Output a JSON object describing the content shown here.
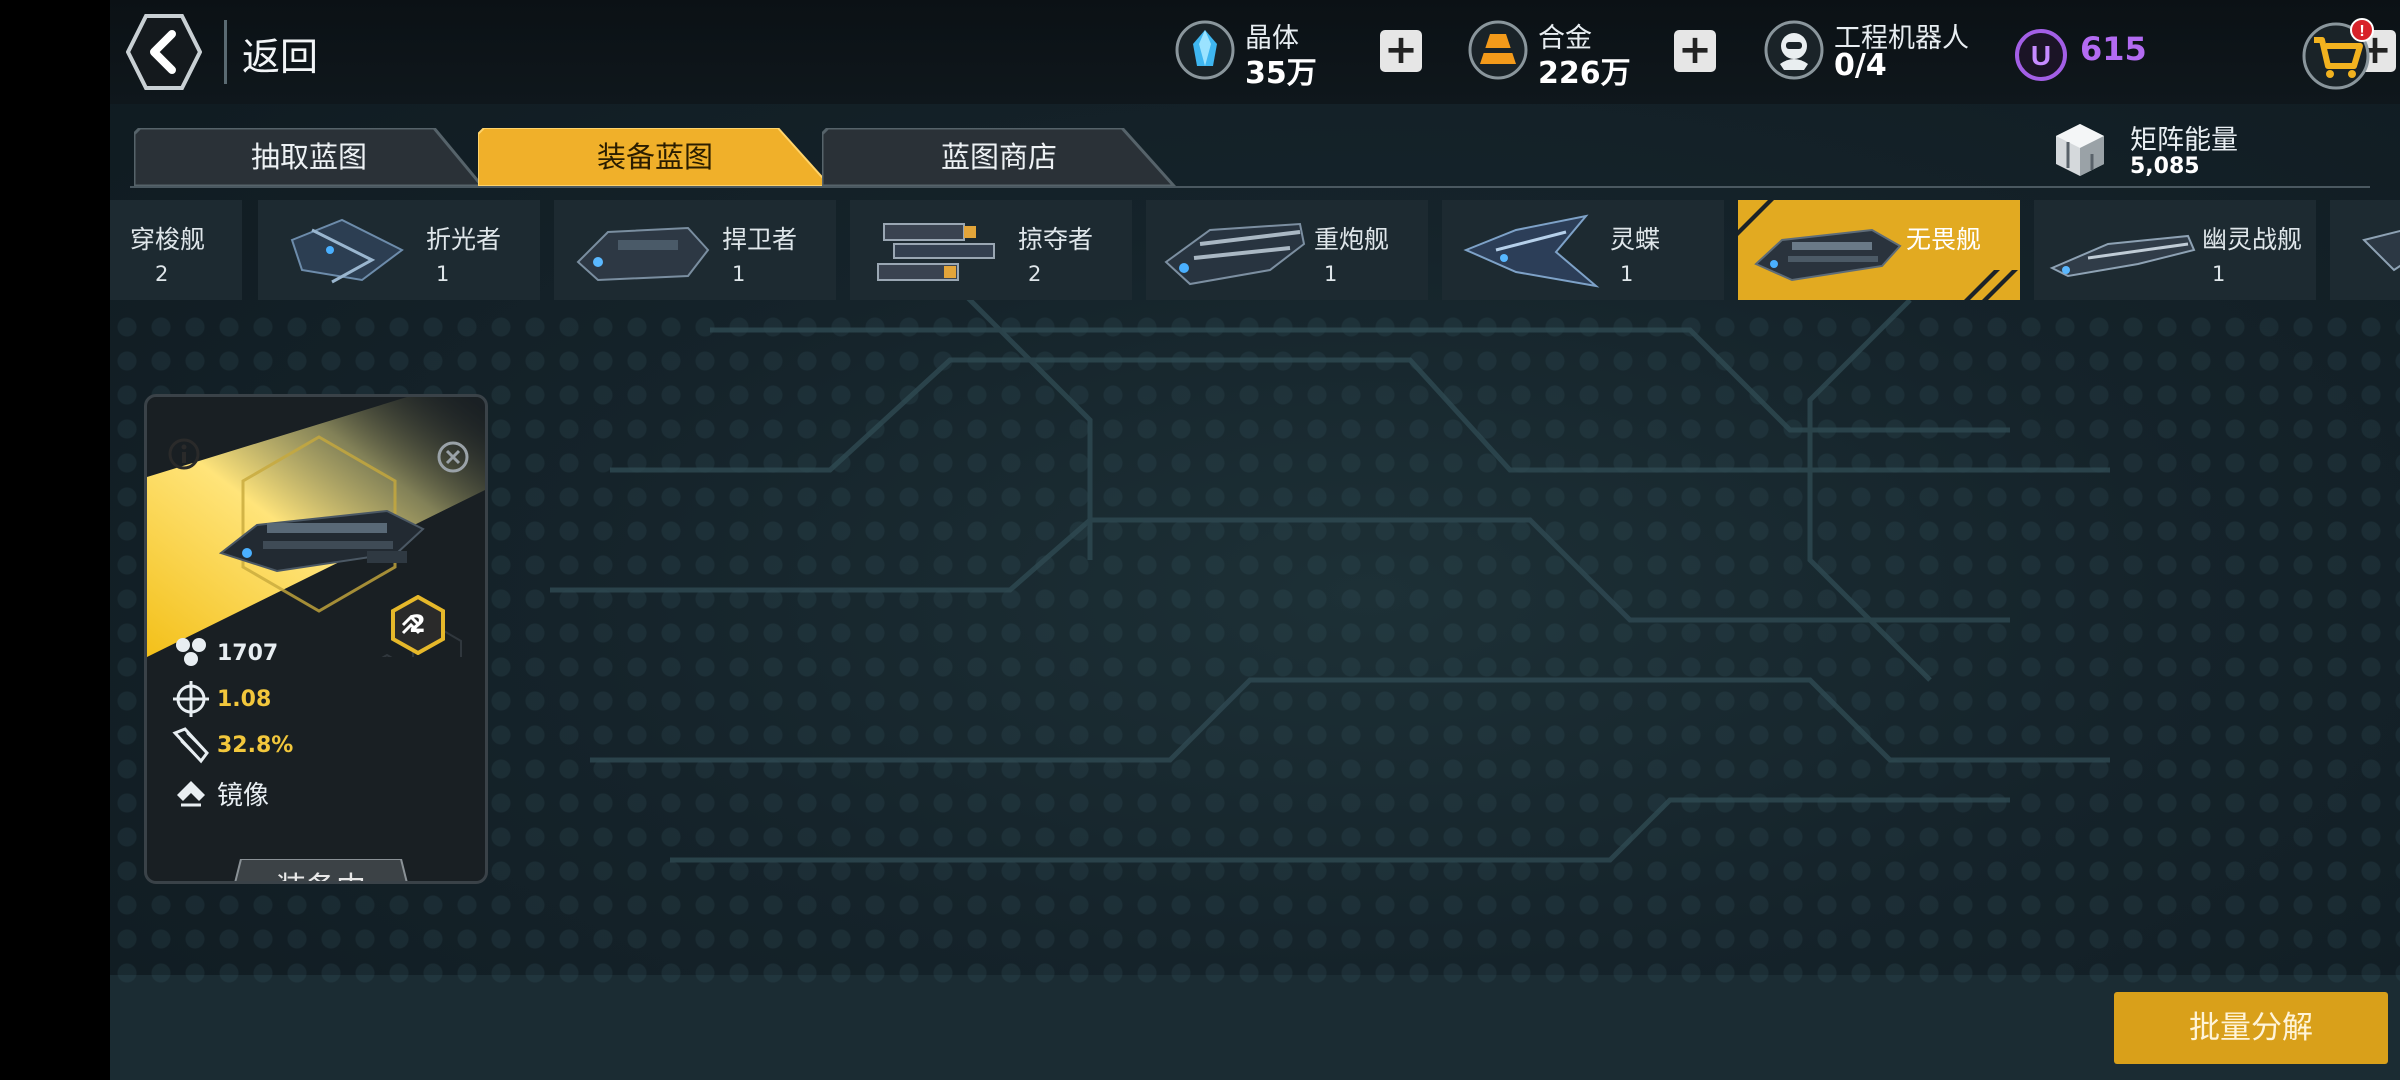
{
  "header": {
    "back_label": "返回",
    "resources": [
      {
        "name": "晶体",
        "value": "35万",
        "icon": "crystal-icon"
      },
      {
        "name": "合金",
        "value": "226万",
        "icon": "alloy-icon"
      },
      {
        "name": "工程机器人",
        "value": "0/4",
        "icon": "robot-icon"
      }
    ],
    "u_currency": {
      "symbol": "U",
      "value": "615",
      "color": "#b36bf2"
    },
    "cart_badge": "!"
  },
  "tabs": [
    {
      "label": "抽取蓝图",
      "active": false
    },
    {
      "label": "装备蓝图",
      "active": true
    },
    {
      "label": "蓝图商店",
      "active": false
    }
  ],
  "matrix_energy": {
    "name": "矩阵能量",
    "value": "5,085"
  },
  "ships": [
    {
      "name": "穿梭舰",
      "count": "2"
    },
    {
      "name": "折光者",
      "count": "1"
    },
    {
      "name": "捍卫者",
      "count": "1"
    },
    {
      "name": "掠夺者",
      "count": "2"
    },
    {
      "name": "重炮舰",
      "count": "1"
    },
    {
      "name": "灵蝶",
      "count": "1"
    },
    {
      "name": "无畏舰",
      "count": "",
      "active": true
    },
    {
      "name": "幽灵战舰",
      "count": "1"
    }
  ],
  "card": {
    "level": "2",
    "stats": [
      {
        "icon": "hull-icon",
        "value": "1707",
        "color": "#e8eef2"
      },
      {
        "icon": "crosshair-icon",
        "value": "1.08",
        "color": "#f2c73c"
      },
      {
        "icon": "missile-icon",
        "value": "32.8%",
        "color": "#f2c73c"
      }
    ],
    "skill": "镜像",
    "status": "装备中"
  },
  "bulk_button": "批量分解",
  "colors": {
    "accent": "#e2aa21",
    "panel": "#1d2a31",
    "bg": "#15232a"
  }
}
